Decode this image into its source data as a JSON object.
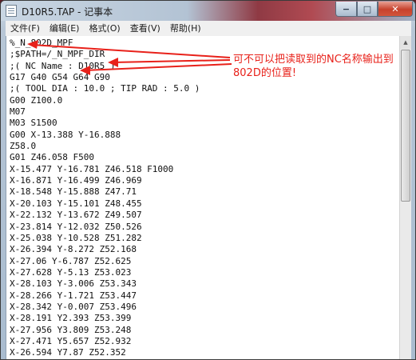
{
  "window": {
    "title": "D10R5.TAP - 记事本",
    "controls": {
      "minimize": "−",
      "maximize": "□",
      "close": "✕"
    }
  },
  "menu": [
    {
      "label": "文件(F)"
    },
    {
      "label": "编辑(E)"
    },
    {
      "label": "格式(O)"
    },
    {
      "label": "查看(V)"
    },
    {
      "label": "帮助(H)"
    }
  ],
  "editor": {
    "lines": [
      "%_N_802D_MPF",
      ";$PATH=/_N_MPF_DIR",
      ";( NC Name : D10R5 )",
      "G17 G40 G54 G64 G90",
      ";( TOOL DIA : 10.0 ; TIP RAD : 5.0 )",
      "G00 Z100.0",
      "M07",
      "M03 S1500",
      "G00 X-13.388 Y-16.888",
      "Z58.0",
      "G01 Z46.058 F500",
      "X-15.477 Y-16.781 Z46.518 F1000",
      "X-16.871 Y-16.499 Z46.969",
      "X-18.548 Y-15.888 Z47.71",
      "X-20.103 Y-15.101 Z48.455",
      "X-22.132 Y-13.672 Z49.507",
      "X-23.814 Y-12.032 Z50.526",
      "X-25.038 Y-10.528 Z51.282",
      "X-26.394 Y-8.272 Z52.168",
      "X-27.06 Y-6.787 Z52.625",
      "X-27.628 Y-5.13 Z53.023",
      "X-28.103 Y-3.006 Z53.343",
      "X-28.266 Y-1.721 Z53.447",
      "X-28.342 Y-0.007 Z53.496",
      "X-28.191 Y2.393 Z53.399",
      "X-27.956 Y3.809 Z53.248",
      "X-27.471 Y5.657 Z52.932",
      "X-26.594 Y7.87 Z52.352"
    ]
  },
  "annotation": {
    "text": "可不可以把读取到的NC名称输出到802D的位置!",
    "color": "#e8211a"
  }
}
